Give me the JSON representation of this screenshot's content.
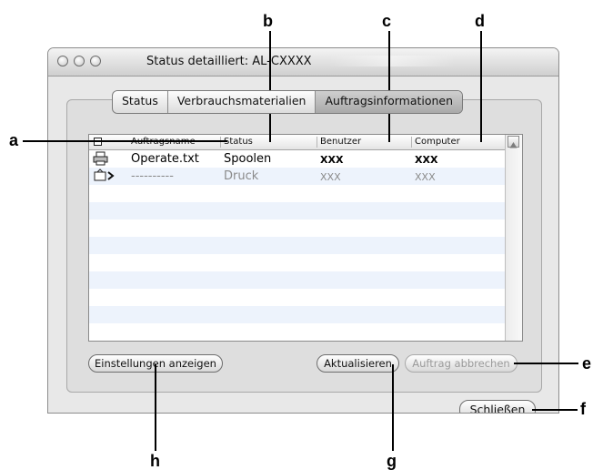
{
  "window": {
    "title": "Status detailliert: AL-CXXXX"
  },
  "tabs": [
    {
      "label": "Status"
    },
    {
      "label": "Verbrauchsmaterialien"
    },
    {
      "label": "Auftragsinformationen"
    }
  ],
  "table": {
    "columns": [
      "Auftragsname",
      "Status",
      "Benutzer",
      "Computer"
    ],
    "rows": [
      {
        "icon": "printer-icon",
        "name": "Operate.txt",
        "status": "Spoolen",
        "user": "XXX",
        "computer": "XXX"
      },
      {
        "icon": "print-queue-arrow-icon",
        "name": "----------",
        "status": "Druck",
        "user": "XXX",
        "computer": "XXX"
      }
    ]
  },
  "buttons": {
    "show_settings": "Einstellungen anzeigen",
    "refresh": "Aktualisieren",
    "cancel_job": "Auftrag abbrechen",
    "close": "Schließen"
  },
  "callouts": {
    "a": "a",
    "b": "b",
    "c": "c",
    "d": "d",
    "e": "e",
    "f": "f",
    "g": "g",
    "h": "h"
  }
}
